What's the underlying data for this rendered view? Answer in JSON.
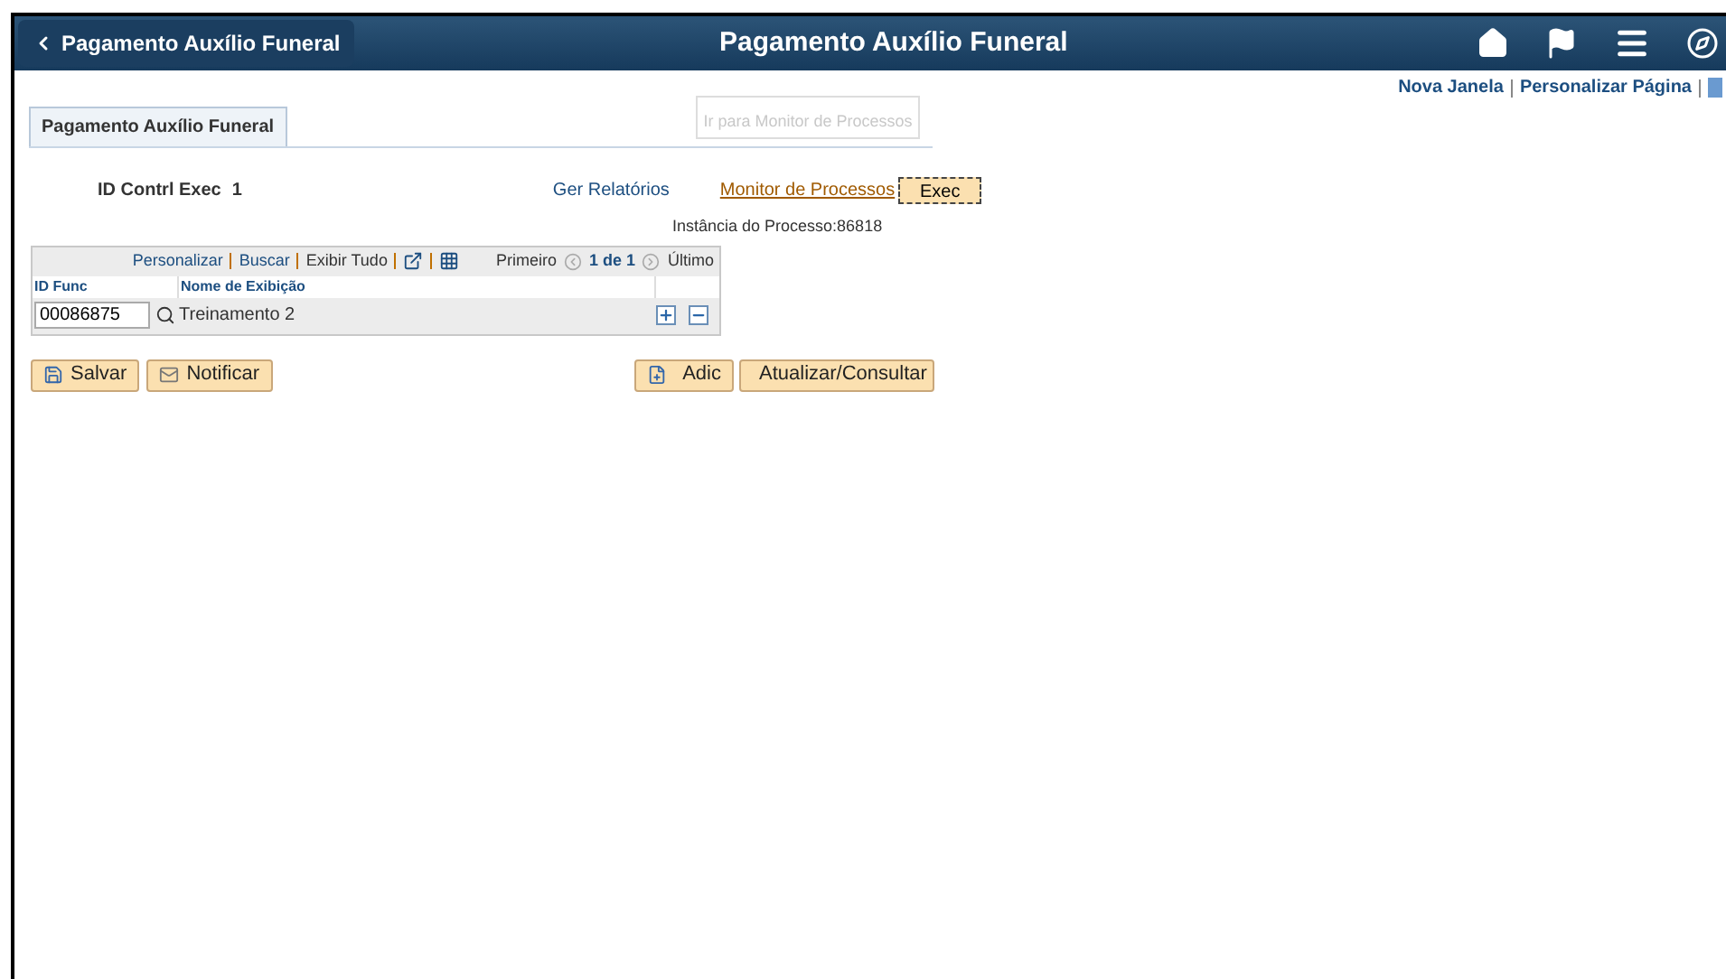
{
  "header": {
    "back_button": "Pagamento Auxílio Funeral",
    "title": "Pagamento Auxílio Funeral"
  },
  "top_links": [
    "Nova Janela",
    "Personalizar Página"
  ],
  "page_tab": {
    "label": "Pagamento Auxílio Funeral",
    "selected": true
  },
  "tooltip": "Ir para Monitor de Processos",
  "run_control": {
    "label": "ID Contrl Exec",
    "value": "1"
  },
  "links": {
    "reports": "Ger Relatórios",
    "monitor": "Monitor de Processos"
  },
  "exec_button": "Exec",
  "process_instance": "Instância do Processo:86818",
  "grid": {
    "toolbar": [
      "Personalizar",
      "Buscar",
      "Exibir Tudo"
    ],
    "first": "Primeiro",
    "range": "1 de 1",
    "last": "Último",
    "columns": [
      "ID Func",
      "Nome de Exibição"
    ],
    "rows": [
      {
        "id": "00086875",
        "name": "Treinamento 2"
      }
    ]
  },
  "left_buttons": [
    "Salvar",
    "Notificar"
  ],
  "right_buttons": [
    "Adic",
    "Atualizar/Consultar"
  ]
}
